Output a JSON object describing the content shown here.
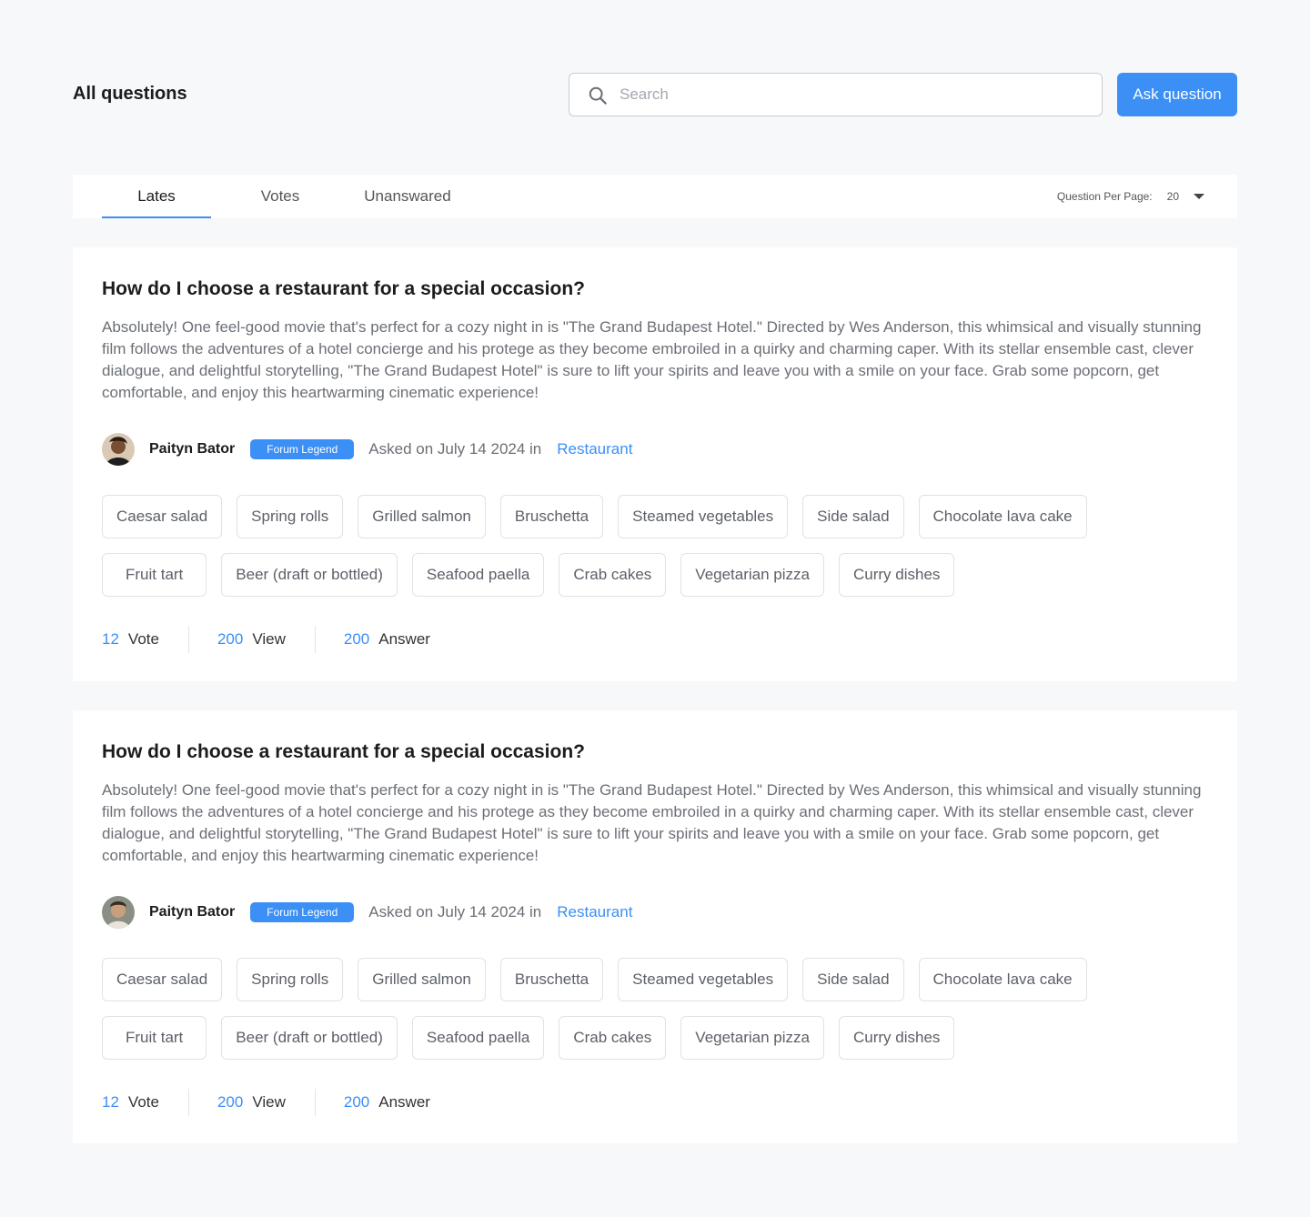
{
  "header": {
    "title": "All questions",
    "search_placeholder": "Search",
    "ask_label": "Ask question"
  },
  "tabs": [
    {
      "label": "Lates",
      "active": true
    },
    {
      "label": "Votes",
      "active": false
    },
    {
      "label": "Unanswared",
      "active": false
    }
  ],
  "per_page": {
    "label": "Question Per Page:",
    "value": "20"
  },
  "colors": {
    "accent": "#3b8ff5",
    "background": "#f7f8fa"
  },
  "questions": [
    {
      "title": "How do I choose a restaurant for a special occasion?",
      "body": "Absolutely! One feel-good movie that's perfect for a cozy night in is \"The Grand Budapest Hotel.\" Directed by Wes Anderson, this whimsical and visually stunning film follows the adventures of a hotel concierge and his protege as they become embroiled in a quirky and charming caper. With its stellar ensemble cast, clever dialogue, and delightful storytelling, \"The Grand Budapest Hotel\" is sure to lift your spirits and leave you with a smile on your face. Grab some popcorn, get comfortable, and enjoy this heartwarming cinematic experience!",
      "author": "Paityn Bator",
      "badge": "Forum Legend",
      "asked": "Asked on July 14 2024 in",
      "category": "Restaurant",
      "tags_row1": [
        "Caesar salad",
        "Spring rolls",
        "Grilled salmon",
        "Bruschetta",
        "Steamed vegetables",
        "Side salad",
        "Chocolate lava cake"
      ],
      "tags_row2": [
        "Fruit tart",
        "Beer (draft or bottled)",
        "Seafood paella",
        "Crab cakes",
        "Vegetarian pizza",
        "Curry dishes"
      ],
      "votes": "12",
      "vote_label": "Vote",
      "views": "200",
      "view_label": "View",
      "answers": "200",
      "answer_label": "Answer"
    },
    {
      "title": "How do I choose a restaurant for a special occasion?",
      "body": "Absolutely! One feel-good movie that's perfect for a cozy night in is \"The Grand Budapest Hotel.\" Directed by Wes Anderson, this whimsical and visually stunning film follows the adventures of a hotel concierge and his protege as they become embroiled in a quirky and charming caper. With its stellar ensemble cast, clever dialogue, and delightful storytelling, \"The Grand Budapest Hotel\" is sure to lift your spirits and leave you with a smile on your face. Grab some popcorn, get comfortable, and enjoy this heartwarming cinematic experience!",
      "author": "Paityn Bator",
      "badge": "Forum Legend",
      "asked": "Asked on July 14 2024 in",
      "category": "Restaurant",
      "tags_row1": [
        "Caesar salad",
        "Spring rolls",
        "Grilled salmon",
        "Bruschetta",
        "Steamed vegetables",
        "Side salad",
        "Chocolate lava cake"
      ],
      "tags_row2": [
        "Fruit tart",
        "Beer (draft or bottled)",
        "Seafood paella",
        "Crab cakes",
        "Vegetarian pizza",
        "Curry dishes"
      ],
      "votes": "12",
      "vote_label": "Vote",
      "views": "200",
      "view_label": "View",
      "answers": "200",
      "answer_label": "Answer"
    }
  ]
}
